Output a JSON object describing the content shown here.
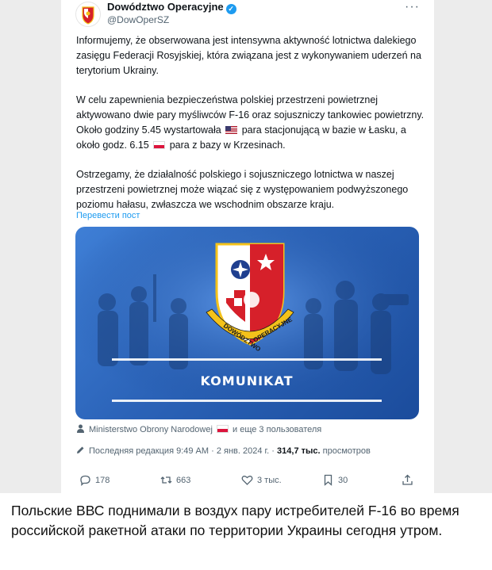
{
  "author": {
    "name": "Dowództwo Operacyjne",
    "handle": "@DowOperSZ"
  },
  "tweet": {
    "paragraph1": "Informujemy, że obserwowana jest  intensywna aktywność lotnictwa dalekiego zasięgu Federacji Rosyjskiej, która związana jest z wykonywaniem uderzeń na terytorium Ukrainy.",
    "paragraph2_a": "W celu zapewnienia bezpieczeństwa polskiej przestrzeni powietrznej aktywowano dwie pary myśliwców F-16 oraz sojuszniczy tankowiec powietrzny. Około godziny 5.45 wystartowała",
    "paragraph2_b": "para stacjonującą w bazie w Łasku, a około godz. 6.15",
    "paragraph2_c": "para z bazy w Krzesinach.",
    "paragraph3": "Ostrzegamy, że działalność polskiego i sojuszniczego lotnictwa w naszej przestrzeni powietrznej może wiązać się z występowaniem podwyższonego poziomu hałasu, zwłaszcza we wschodnim obszarze kraju.",
    "translate_link": "Перевести пост"
  },
  "media": {
    "emblem_top": "DOWÓDZTWO",
    "emblem_bottom": "OPERACYJNE",
    "banner_text": "KOMUNIKAT"
  },
  "meta": {
    "coauthors_name": "Ministerstwo Obrony Narodowej",
    "coauthors_rest": "и еще 3 пользователя",
    "edited_prefix": "Последняя редакция 9:49 AM · 2 янв. 2024 г. ·",
    "views_count": "314,7 тыс.",
    "views_label": "просмотров"
  },
  "actions": {
    "replies": "178",
    "reposts": "663",
    "likes": "3 тыс.",
    "bookmarks": "30"
  },
  "caption": "Польские ВВС поднимали в воздух пару истребителей F-16 во время российской ракетной атаки по территории Украины сегодня утром.",
  "colors": {
    "link": "#1d9bf0",
    "verified": "#1d9bf0",
    "media_blue": "#2b63b8",
    "emblem_red": "#d6202a",
    "emblem_gold": "#f4c21a"
  }
}
